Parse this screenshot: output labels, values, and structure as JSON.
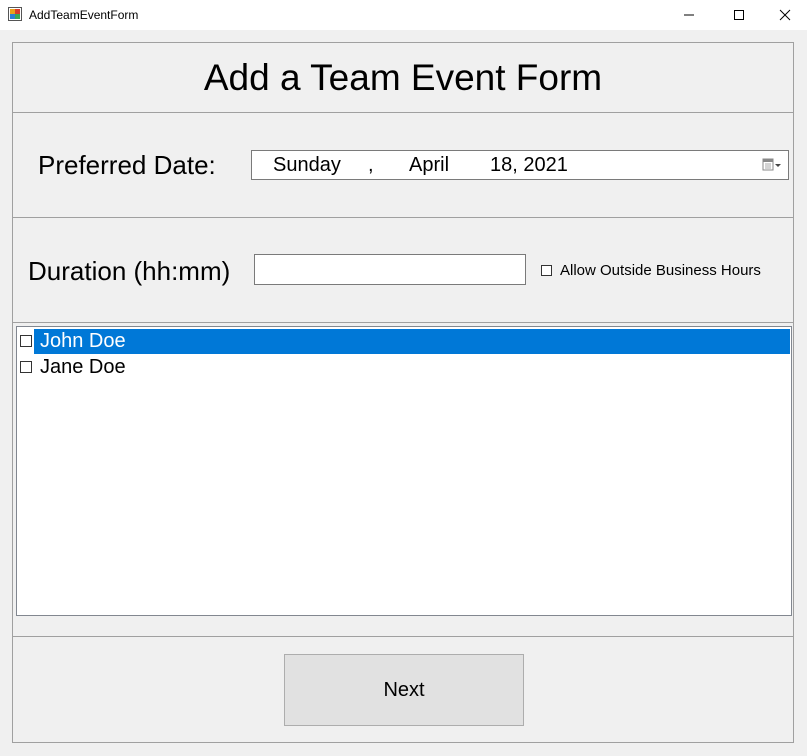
{
  "window": {
    "title": "AddTeamEventForm"
  },
  "form": {
    "heading": "Add a Team Event Form",
    "preferred_date": {
      "label": "Preferred Date:",
      "weekday": "Sunday",
      "comma": ",",
      "month": "April",
      "day_year": "18, 2021"
    },
    "duration": {
      "label": "Duration (hh:mm)",
      "value": ""
    },
    "allow_outside": {
      "label": "Allow Outside Business Hours",
      "checked": false
    },
    "team_members": [
      {
        "name": "John Doe",
        "checked": false,
        "selected": true
      },
      {
        "name": "Jane Doe",
        "checked": false,
        "selected": false
      }
    ],
    "next_label": "Next"
  },
  "colors": {
    "selection": "#0078d7",
    "window_bg": "#f0f0f0"
  },
  "icons": [
    "app-icon",
    "minimize-icon",
    "maximize-icon",
    "close-icon",
    "calendar-dropdown-icon"
  ]
}
